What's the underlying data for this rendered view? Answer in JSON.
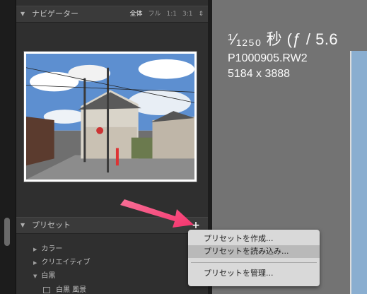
{
  "navigator": {
    "title": "ナビゲーター",
    "zoom_options": [
      "全体",
      "フル",
      "1:1",
      "3:1"
    ],
    "active_zoom": "全体"
  },
  "photo_info": {
    "shutter_line": "¹⁄₁₂₅₀ 秒 (ƒ / 5.6",
    "filename": "P1000905.RW2",
    "dimensions": "5184 x 3888"
  },
  "presets": {
    "title": "プリセット",
    "items": [
      {
        "label": "カラー",
        "expanded": false
      },
      {
        "label": "クリエイティブ",
        "expanded": false
      },
      {
        "label": "白黒",
        "expanded": true
      },
      {
        "label": "白黒 風景",
        "child": true
      }
    ]
  },
  "context_menu": {
    "items": [
      {
        "label": "プリセットを作成..."
      },
      {
        "label": "プリセットを読み込み...",
        "highlighted": true
      },
      {
        "label": "プリセットを管理..."
      }
    ]
  },
  "colors": {
    "arrow": "#f5356e",
    "menu_bg": "#d9d9d9",
    "highlight": "#b9b9b9"
  }
}
